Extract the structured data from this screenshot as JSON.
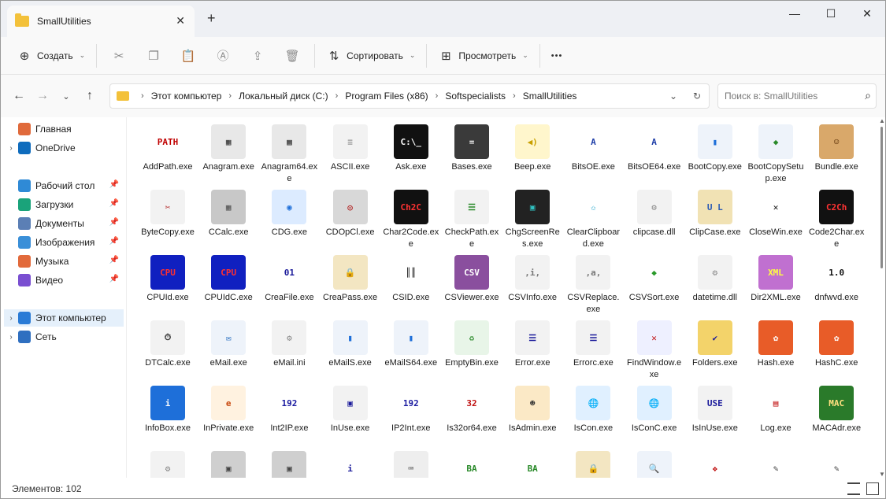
{
  "window": {
    "tab_title": "SmallUtilities",
    "tab_close": "✕",
    "new_tab": "+",
    "minimize": "—",
    "maximize": "☐",
    "close": "✕"
  },
  "toolbar": {
    "create_label": "Создать",
    "sort_label": "Сортировать",
    "view_label": "Просмотреть",
    "more_label": "•••"
  },
  "address": {
    "crumbs": [
      "Этот компьютер",
      "Локальный диск (C:)",
      "Program Files (x86)",
      "Softspecialists",
      "SmallUtilities"
    ],
    "search_placeholder": "Поиск в: SmallUtilities"
  },
  "sidebar": {
    "items": [
      {
        "label": "Главная",
        "icon": "home-icon",
        "color": "#e06a3b",
        "arrow": false,
        "pin": false
      },
      {
        "label": "OneDrive",
        "icon": "cloud-icon",
        "color": "#0f6cbd",
        "arrow": true,
        "pin": false
      },
      {
        "label": "Рабочий стол",
        "icon": "desktop-icon",
        "color": "#2f8ad6",
        "arrow": false,
        "pin": true
      },
      {
        "label": "Загрузки",
        "icon": "download-icon",
        "color": "#1aa37a",
        "arrow": false,
        "pin": true
      },
      {
        "label": "Документы",
        "icon": "documents-icon",
        "color": "#5b7fb5",
        "arrow": false,
        "pin": true
      },
      {
        "label": "Изображения",
        "icon": "pictures-icon",
        "color": "#3a8fd8",
        "arrow": false,
        "pin": true
      },
      {
        "label": "Музыка",
        "icon": "music-icon",
        "color": "#e26a3b",
        "arrow": false,
        "pin": true
      },
      {
        "label": "Видео",
        "icon": "video-icon",
        "color": "#7a4fd1",
        "arrow": false,
        "pin": true
      },
      {
        "label": "Этот компьютер",
        "icon": "computer-icon",
        "color": "#2a7bd6",
        "arrow": true,
        "pin": false
      },
      {
        "label": "Сеть",
        "icon": "network-icon",
        "color": "#2f6fc0",
        "arrow": true,
        "pin": false
      }
    ]
  },
  "files": [
    {
      "name": "AddPath.exe",
      "bg": "#ffffff",
      "fg": "#c00000",
      "glyph": "PATH"
    },
    {
      "name": "Anagram.exe",
      "bg": "#e8e8e8",
      "fg": "#333333",
      "glyph": "▦"
    },
    {
      "name": "Anagram64.exe",
      "bg": "#e8e8e8",
      "fg": "#333333",
      "glyph": "▦"
    },
    {
      "name": "ASCII.exe",
      "bg": "#f2f2f2",
      "fg": "#999999",
      "glyph": "≡"
    },
    {
      "name": "Ask.exe",
      "bg": "#111111",
      "fg": "#ffffff",
      "glyph": "C:\\_"
    },
    {
      "name": "Bases.exe",
      "bg": "#3a3a3a",
      "fg": "#ffffff",
      "glyph": "="
    },
    {
      "name": "Beep.exe",
      "bg": "#fff6cc",
      "fg": "#c9a000",
      "glyph": "◀)"
    },
    {
      "name": "BitsOE.exe",
      "bg": "#ffffff",
      "fg": "#1f3fa8",
      "glyph": "A"
    },
    {
      "name": "BitsOE64.exe",
      "bg": "#ffffff",
      "fg": "#1f3fa8",
      "glyph": "A"
    },
    {
      "name": "BootCopy.exe",
      "bg": "#eef3fa",
      "fg": "#1e6fd9",
      "glyph": "▮"
    },
    {
      "name": "BootCopySetup.exe",
      "bg": "#eef3fa",
      "fg": "#2a8a2a",
      "glyph": "◆"
    },
    {
      "name": "Bundle.exe",
      "bg": "#d9a86a",
      "fg": "#6b3f12",
      "glyph": "☺"
    },
    {
      "name": "ByteCopy.exe",
      "bg": "#f2f2f2",
      "fg": "#b02020",
      "glyph": "✂"
    },
    {
      "name": "CCalc.exe",
      "bg": "#c8c8c8",
      "fg": "#555555",
      "glyph": "▦"
    },
    {
      "name": "CDG.exe",
      "bg": "#dcebff",
      "fg": "#1e6fd9",
      "glyph": "◉"
    },
    {
      "name": "CDOpCl.exe",
      "bg": "#d8d8d8",
      "fg": "#b02020",
      "glyph": "◎"
    },
    {
      "name": "Char2Code.exe",
      "bg": "#111111",
      "fg": "#ff3333",
      "glyph": "Ch2C"
    },
    {
      "name": "CheckPath.exe",
      "bg": "#f2f2f2",
      "fg": "#2a8a2a",
      "glyph": "☰"
    },
    {
      "name": "ChgScreenRes.exe",
      "bg": "#222222",
      "fg": "#30c0c0",
      "glyph": "▣"
    },
    {
      "name": "ClearClipboard.exe",
      "bg": "#ffffff",
      "fg": "#14a0c8",
      "glyph": "✩"
    },
    {
      "name": "clipcase.dll",
      "bg": "#f2f2f2",
      "fg": "#888888",
      "glyph": "⚙"
    },
    {
      "name": "ClipCase.exe",
      "bg": "#f1e2b4",
      "fg": "#2a5bb5",
      "glyph": "U L"
    },
    {
      "name": "CloseWin.exe",
      "bg": "#ffffff",
      "fg": "#111111",
      "glyph": "✕"
    },
    {
      "name": "Code2Char.exe",
      "bg": "#111111",
      "fg": "#ff3333",
      "glyph": "C2Ch"
    },
    {
      "name": "CPUId.exe",
      "bg": "#1020c0",
      "fg": "#ff3030",
      "glyph": "CPU"
    },
    {
      "name": "CPUIdC.exe",
      "bg": "#1020c0",
      "fg": "#ff3030",
      "glyph": "CPU"
    },
    {
      "name": "CreaFile.exe",
      "bg": "#ffffff",
      "fg": "#1a1a9a",
      "glyph": "01"
    },
    {
      "name": "CreaPass.exe",
      "bg": "#f3e6c2",
      "fg": "#8a6a20",
      "glyph": "🔒"
    },
    {
      "name": "CSID.exe",
      "bg": "#ffffff",
      "fg": "#111111",
      "glyph": "║║"
    },
    {
      "name": "CSViewer.exe",
      "bg": "#8a4f9e",
      "fg": "#ffffff",
      "glyph": "CSV"
    },
    {
      "name": "CSVInfo.exe",
      "bg": "#f2f2f2",
      "fg": "#777777",
      "glyph": ",i,"
    },
    {
      "name": "CSVReplace.exe",
      "bg": "#f2f2f2",
      "fg": "#777777",
      "glyph": ",a,"
    },
    {
      "name": "CSVSort.exe",
      "bg": "#ffffff",
      "fg": "#2a9a2a",
      "glyph": "◆"
    },
    {
      "name": "datetime.dll",
      "bg": "#f2f2f2",
      "fg": "#888888",
      "glyph": "⚙"
    },
    {
      "name": "Dir2XML.exe",
      "bg": "#c070d0",
      "fg": "#ffff40",
      "glyph": "XML"
    },
    {
      "name": "dnfwvd.exe",
      "bg": "#ffffff",
      "fg": "#111111",
      "glyph": "1.0"
    },
    {
      "name": "DTCalc.exe",
      "bg": "#f2f2f2",
      "fg": "#333333",
      "glyph": "⏱"
    },
    {
      "name": "eMail.exe",
      "bg": "#eef3fa",
      "fg": "#2a6fc0",
      "glyph": "✉"
    },
    {
      "name": "eMail.ini",
      "bg": "#f2f2f2",
      "fg": "#888888",
      "glyph": "⚙"
    },
    {
      "name": "eMailS.exe",
      "bg": "#eef3fa",
      "fg": "#1e6fd9",
      "glyph": "▮"
    },
    {
      "name": "eMailS64.exe",
      "bg": "#eef3fa",
      "fg": "#1e6fd9",
      "glyph": "▮"
    },
    {
      "name": "EmptyBin.exe",
      "bg": "#e8f5e8",
      "fg": "#2a8a2a",
      "glyph": "♻"
    },
    {
      "name": "Error.exe",
      "bg": "#f2f2f2",
      "fg": "#1a1a9a",
      "glyph": "☰"
    },
    {
      "name": "Errorc.exe",
      "bg": "#f2f2f2",
      "fg": "#1a1a9a",
      "glyph": "☰"
    },
    {
      "name": "FindWindow.exe",
      "bg": "#eef0ff",
      "fg": "#c01010",
      "glyph": "✕"
    },
    {
      "name": "Folders.exe",
      "bg": "#f3d36a",
      "fg": "#1a1a9a",
      "glyph": "✔"
    },
    {
      "name": "Hash.exe",
      "bg": "#e85c28",
      "fg": "#ffffff",
      "glyph": "✿"
    },
    {
      "name": "HashC.exe",
      "bg": "#e85c28",
      "fg": "#ffffff",
      "glyph": "✿"
    },
    {
      "name": "InfoBox.exe",
      "bg": "#1e6fd9",
      "fg": "#ffffff",
      "glyph": "i"
    },
    {
      "name": "InPrivate.exe",
      "bg": "#fff2e0",
      "fg": "#c84a10",
      "glyph": "e"
    },
    {
      "name": "Int2IP.exe",
      "bg": "#ffffff",
      "fg": "#1a1aa0",
      "glyph": "192"
    },
    {
      "name": "InUse.exe",
      "bg": "#f2f2f2",
      "fg": "#1a1a9a",
      "glyph": "▣"
    },
    {
      "name": "IP2Int.exe",
      "bg": "#ffffff",
      "fg": "#1a1aa0",
      "glyph": "192"
    },
    {
      "name": "Is32or64.exe",
      "bg": "#ffffff",
      "fg": "#c01010",
      "glyph": "32"
    },
    {
      "name": "IsAdmin.exe",
      "bg": "#fbe9c6",
      "fg": "#333333",
      "glyph": "☻"
    },
    {
      "name": "IsCon.exe",
      "bg": "#e0f0ff",
      "fg": "#2a8a2a",
      "glyph": "🌐"
    },
    {
      "name": "IsConC.exe",
      "bg": "#e0f0ff",
      "fg": "#2a8a2a",
      "glyph": "🌐"
    },
    {
      "name": "IsInUse.exe",
      "bg": "#f2f2f2",
      "fg": "#1a1a9a",
      "glyph": "USE"
    },
    {
      "name": "Log.exe",
      "bg": "#ffffff",
      "fg": "#c01010",
      "glyph": "▤"
    },
    {
      "name": "MACAdr.exe",
      "bg": "#2a7a2a",
      "fg": "#ffe080",
      "glyph": "MAC"
    },
    {
      "name": "",
      "bg": "#f2f2f2",
      "fg": "#888888",
      "glyph": "⚙"
    },
    {
      "name": "",
      "bg": "#cfcfcf",
      "fg": "#444444",
      "glyph": "▣"
    },
    {
      "name": "",
      "bg": "#cfcfcf",
      "fg": "#444444",
      "glyph": "▣"
    },
    {
      "name": "",
      "bg": "#ffffff",
      "fg": "#1a1a9a",
      "glyph": "i"
    },
    {
      "name": "",
      "bg": "#eeeeee",
      "fg": "#333333",
      "glyph": "⌨"
    },
    {
      "name": "",
      "bg": "#ffffff",
      "fg": "#2a8a2a",
      "glyph": "BA"
    },
    {
      "name": "",
      "bg": "#ffffff",
      "fg": "#2a8a2a",
      "glyph": "BA"
    },
    {
      "name": "",
      "bg": "#f3e6c2",
      "fg": "#8a6a20",
      "glyph": "🔒"
    },
    {
      "name": "",
      "bg": "#eef3fa",
      "fg": "#1e6fd9",
      "glyph": "🔍"
    },
    {
      "name": "",
      "bg": "#ffffff",
      "fg": "#c01010",
      "glyph": "❖"
    },
    {
      "name": "",
      "bg": "#ffffff",
      "fg": "#444444",
      "glyph": "✎"
    },
    {
      "name": "",
      "bg": "#ffffff",
      "fg": "#444444",
      "glyph": "✎"
    }
  ],
  "status": {
    "count_text": "Элементов: 102"
  }
}
